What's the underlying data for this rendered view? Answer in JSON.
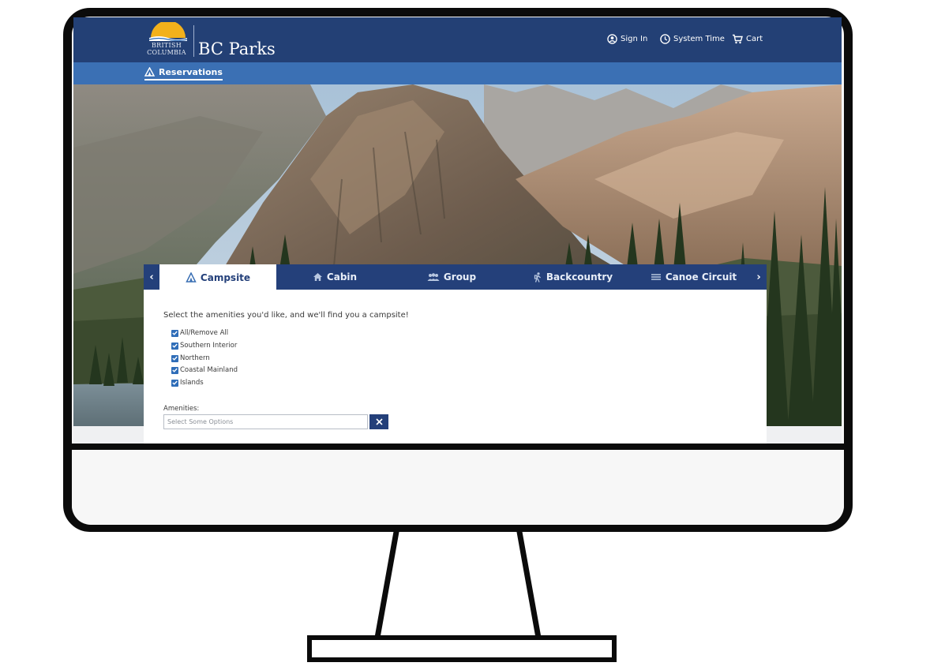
{
  "header": {
    "logo_small_top": "British",
    "logo_small_bottom": "Columbia",
    "logo_title": "BC Parks",
    "links": [
      {
        "label": "Sign In",
        "icon": "user-circle-icon"
      },
      {
        "label": "System Time",
        "icon": "clock-icon"
      },
      {
        "label": "Cart",
        "icon": "cart-icon"
      }
    ]
  },
  "subnav": {
    "reservations_label": "Reservations",
    "icon": "tent-icon"
  },
  "tabs": [
    {
      "label": "Campsite",
      "icon": "tent-icon",
      "active": true
    },
    {
      "label": "Cabin",
      "icon": "home-icon",
      "active": false
    },
    {
      "label": "Group",
      "icon": "group-icon",
      "active": false
    },
    {
      "label": "Backcountry",
      "icon": "hiker-icon",
      "active": false
    },
    {
      "label": "Canoe Circuit",
      "icon": "waves-icon",
      "active": false
    }
  ],
  "arrows": {
    "prev": "‹",
    "next": "›"
  },
  "panel": {
    "heading": "Select the amenities you'd like, and we'll find you a campsite!",
    "regions": [
      {
        "label": "All/Remove All",
        "checked": true
      },
      {
        "label": "Southern Interior",
        "checked": true
      },
      {
        "label": "Northern",
        "checked": true
      },
      {
        "label": "Coastal Mainland",
        "checked": true
      },
      {
        "label": "Islands",
        "checked": true
      }
    ],
    "amenities_label": "Amenities:",
    "amenities_placeholder": "Select Some Options"
  },
  "colors": {
    "topbar": "#234075",
    "subnav": "#3b70b4",
    "tabbar": "#24407a",
    "checkbox": "#2f6db8"
  }
}
